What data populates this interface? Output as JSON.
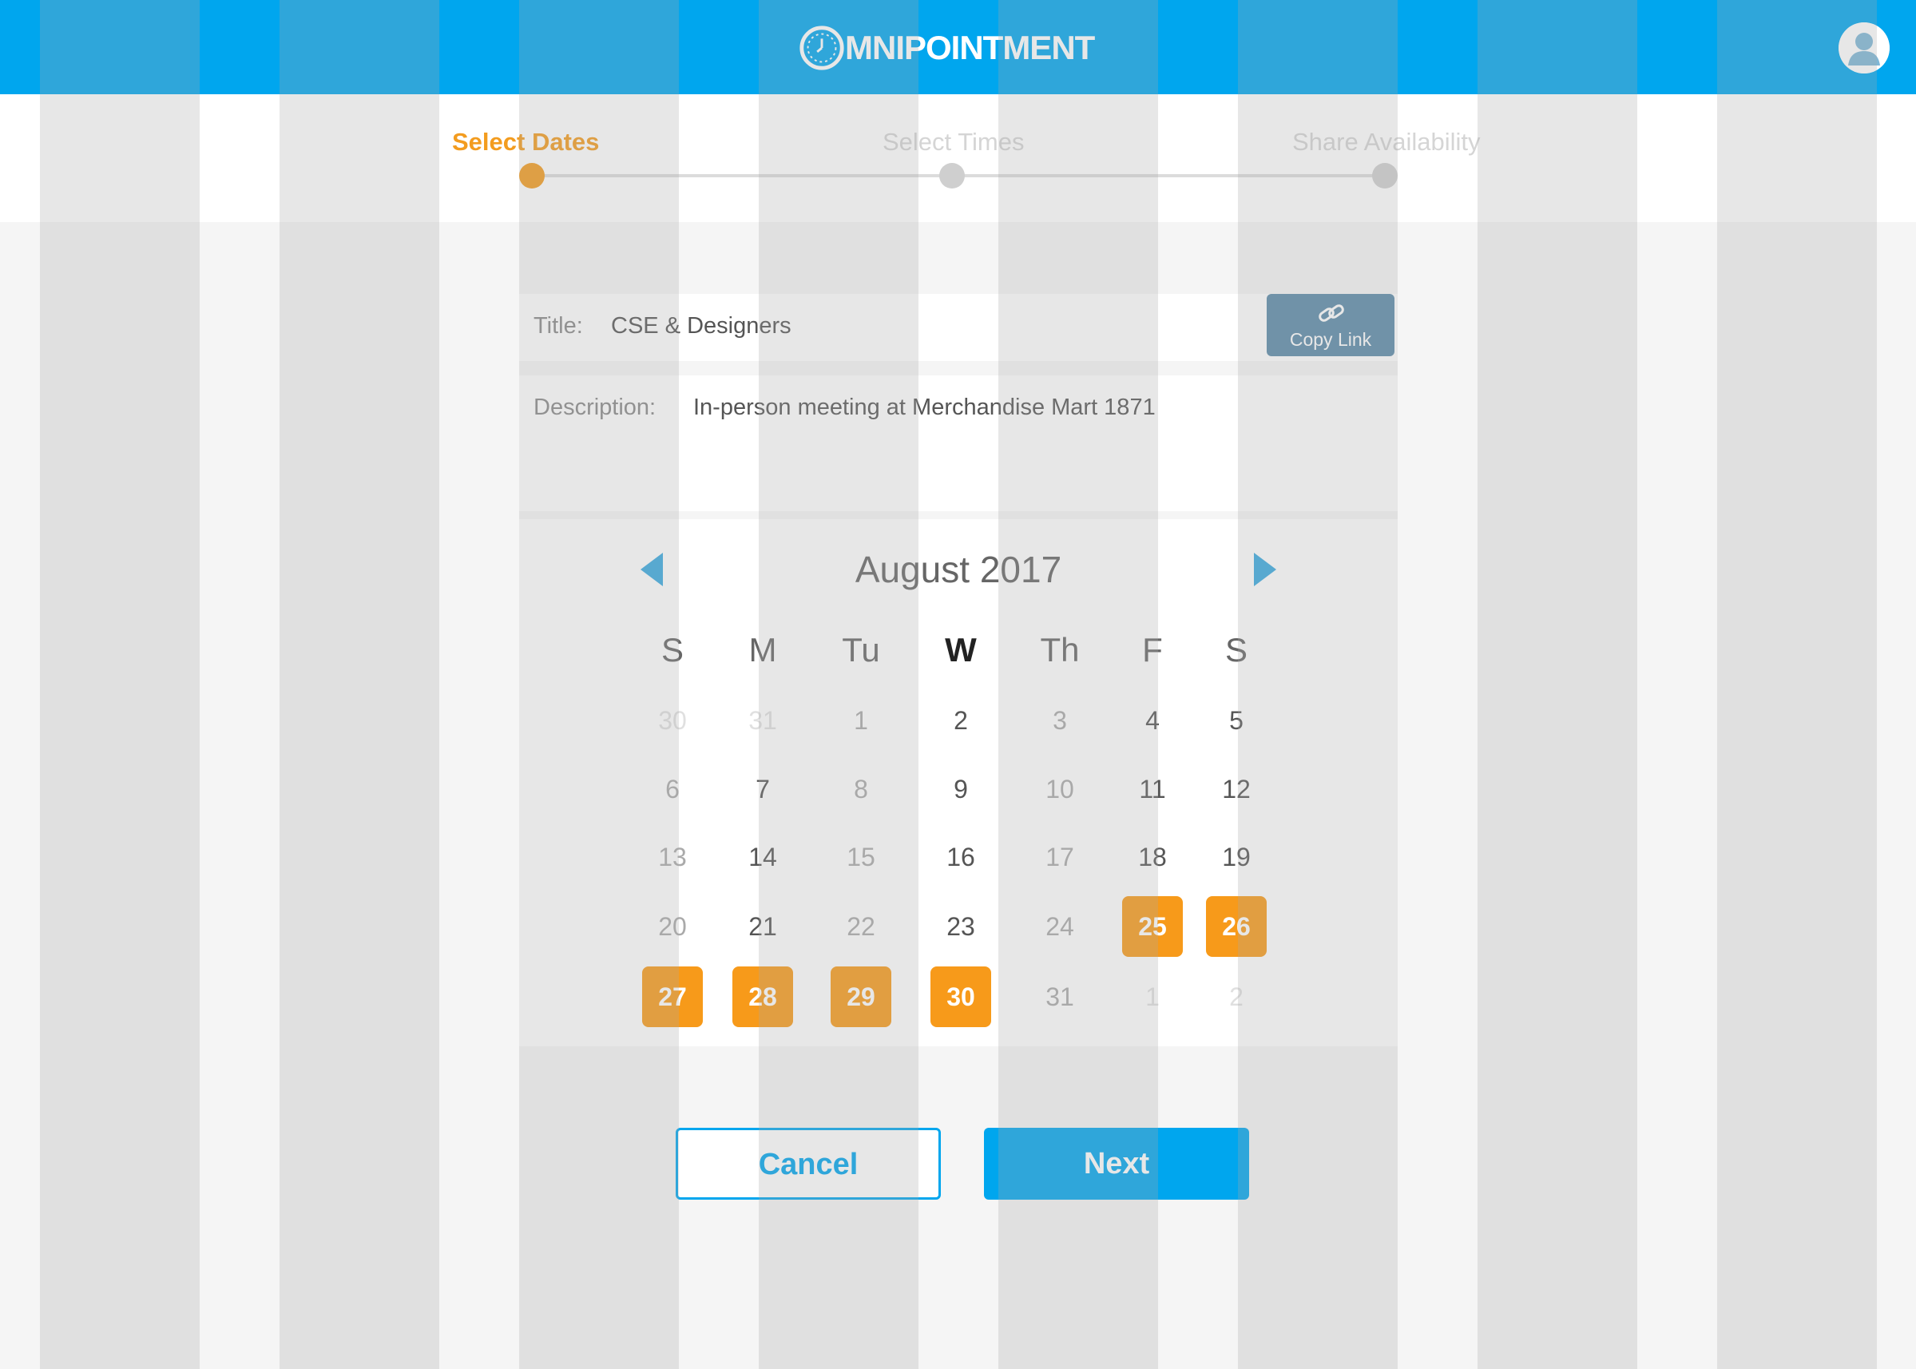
{
  "header": {
    "brand_text": "MNIPOINTMENT",
    "brand_color": "#00a6ee",
    "logo_icon": "clock-icon",
    "avatar_icon": "user-avatar-icon"
  },
  "stepper": {
    "steps": [
      {
        "label": "Select Dates",
        "state": "active"
      },
      {
        "label": "Select Times",
        "state": "inactive"
      },
      {
        "label": "Share Availability",
        "state": "inactive"
      }
    ],
    "active_color": "#f39c1f"
  },
  "form": {
    "title_label": "Title:",
    "title_value": "CSE & Designers",
    "description_label": "Description:",
    "description_value": "In-person meeting at Merchandise Mart 1871",
    "copy_link_label": "Copy Link",
    "copy_link_icon": "link-icon"
  },
  "calendar": {
    "month_label": "August 2017",
    "prev_icon": "caret-left-icon",
    "next_icon": "caret-right-icon",
    "weekdays": [
      "S",
      "M",
      "Tu",
      "W",
      "Th",
      "F",
      "S"
    ],
    "today_weekday_index": 3,
    "weeks": [
      [
        "30",
        "31",
        "1",
        "2",
        "3",
        "4",
        "5"
      ],
      [
        "6",
        "7",
        "8",
        "9",
        "10",
        "11",
        "12"
      ],
      [
        "13",
        "14",
        "15",
        "16",
        "17",
        "18",
        "19"
      ],
      [
        "20",
        "21",
        "22",
        "23",
        "24",
        "25",
        "26"
      ],
      [
        "27",
        "28",
        "29",
        "30",
        "31",
        "1",
        "2"
      ]
    ],
    "muted_days": [
      [
        0,
        0
      ],
      [
        0,
        1
      ],
      [
        4,
        5
      ],
      [
        4,
        6
      ]
    ],
    "past_days": [
      [
        0,
        2
      ],
      [
        1,
        0
      ],
      [
        1,
        2
      ],
      [
        2,
        0
      ],
      [
        2,
        2
      ],
      [
        3,
        0
      ],
      [
        3,
        2
      ],
      [
        0,
        4
      ],
      [
        1,
        4
      ],
      [
        2,
        4
      ],
      [
        3,
        4
      ],
      [
        4,
        4
      ]
    ],
    "selected_days": [
      "25",
      "26",
      "27",
      "28",
      "29",
      "30"
    ],
    "selected_color": "#f79a1a"
  },
  "actions": {
    "cancel_label": "Cancel",
    "next_label": "Next"
  }
}
